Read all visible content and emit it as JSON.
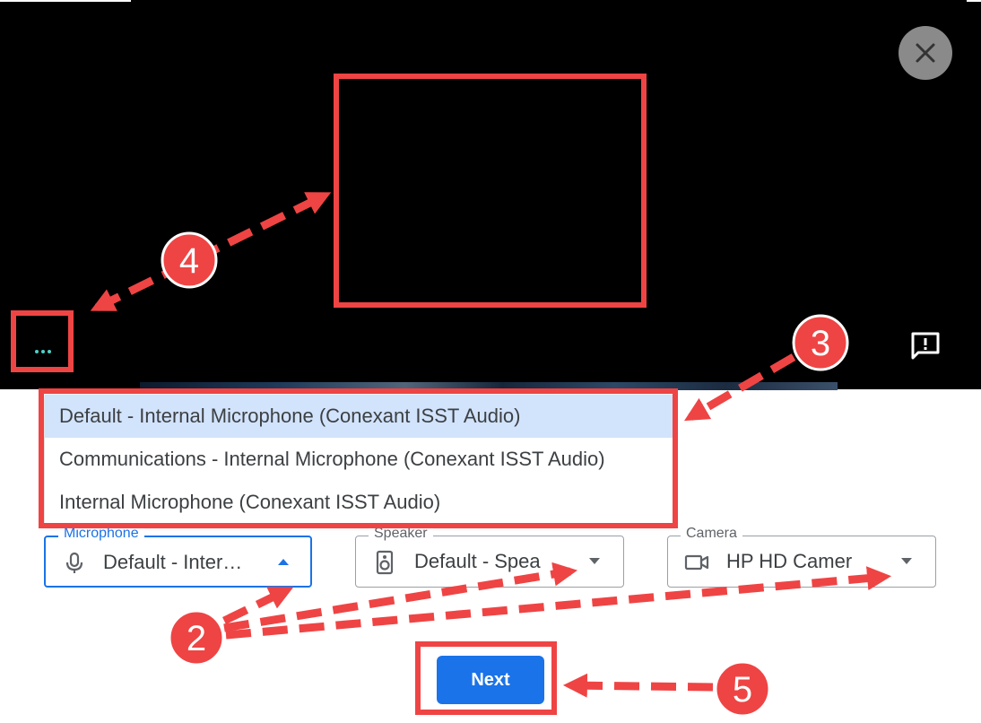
{
  "dialog": {
    "close_icon": "close-icon",
    "more_options_icon": "more-horiz-icon",
    "feedback_icon": "feedback-icon"
  },
  "microphone_menu": {
    "options": [
      "Default - Internal Microphone (Conexant ISST Audio)",
      "Communications - Internal Microphone (Conexant ISST Audio)",
      "Internal Microphone (Conexant ISST Audio)"
    ],
    "selected_index": 0
  },
  "devices": {
    "microphone": {
      "label": "Microphone",
      "value": "Default - Inter…",
      "icon": "microphone-icon"
    },
    "speaker": {
      "label": "Speaker",
      "value": "Default - Spea",
      "icon": "speaker-icon"
    },
    "camera": {
      "label": "Camera",
      "value": "HP HD Camer",
      "icon": "videocam-icon"
    }
  },
  "next_button": {
    "label": "Next"
  },
  "annotations": {
    "markers": [
      "2",
      "3",
      "4",
      "5"
    ]
  },
  "colors": {
    "annotation_red": "#ef4444",
    "accent_blue": "#1a73e8",
    "selected_option_bg": "#d2e3fc",
    "preview_bg": "#000000"
  }
}
